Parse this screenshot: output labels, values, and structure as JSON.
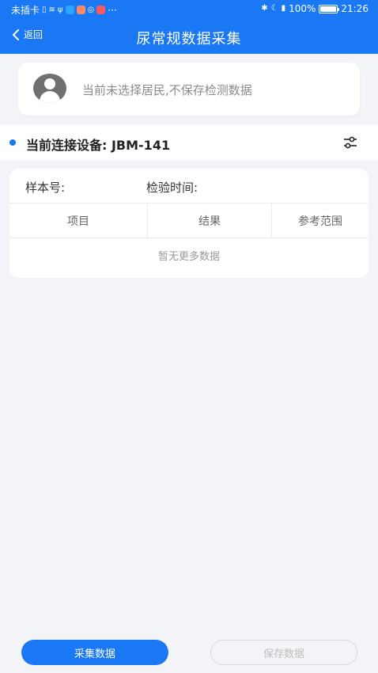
{
  "status_bar": {
    "carrier": "未插卡",
    "battery": "100%",
    "time": "21:26",
    "more": "···",
    "app_icon_colors": [
      "#29a8ff",
      "#ff8a65",
      "#ff5a5f"
    ]
  },
  "header": {
    "back_label": "返回",
    "title": "尿常规数据采集"
  },
  "resident": {
    "message": "当前未选择居民,不保存检测数据"
  },
  "device": {
    "label": "当前连接设备:  JBM-141",
    "settings_icon": "sliders-icon"
  },
  "record": {
    "sample_label": "样本号:",
    "time_label": "检验时间:",
    "columns": [
      "项目",
      "结果",
      "参考范围"
    ],
    "empty_text": "暂无更多数据"
  },
  "actions": {
    "collect_label": "采集数据",
    "save_label": "保存数据"
  },
  "colors": {
    "accent": "#1a78f5",
    "background": "#f3f4f8"
  }
}
